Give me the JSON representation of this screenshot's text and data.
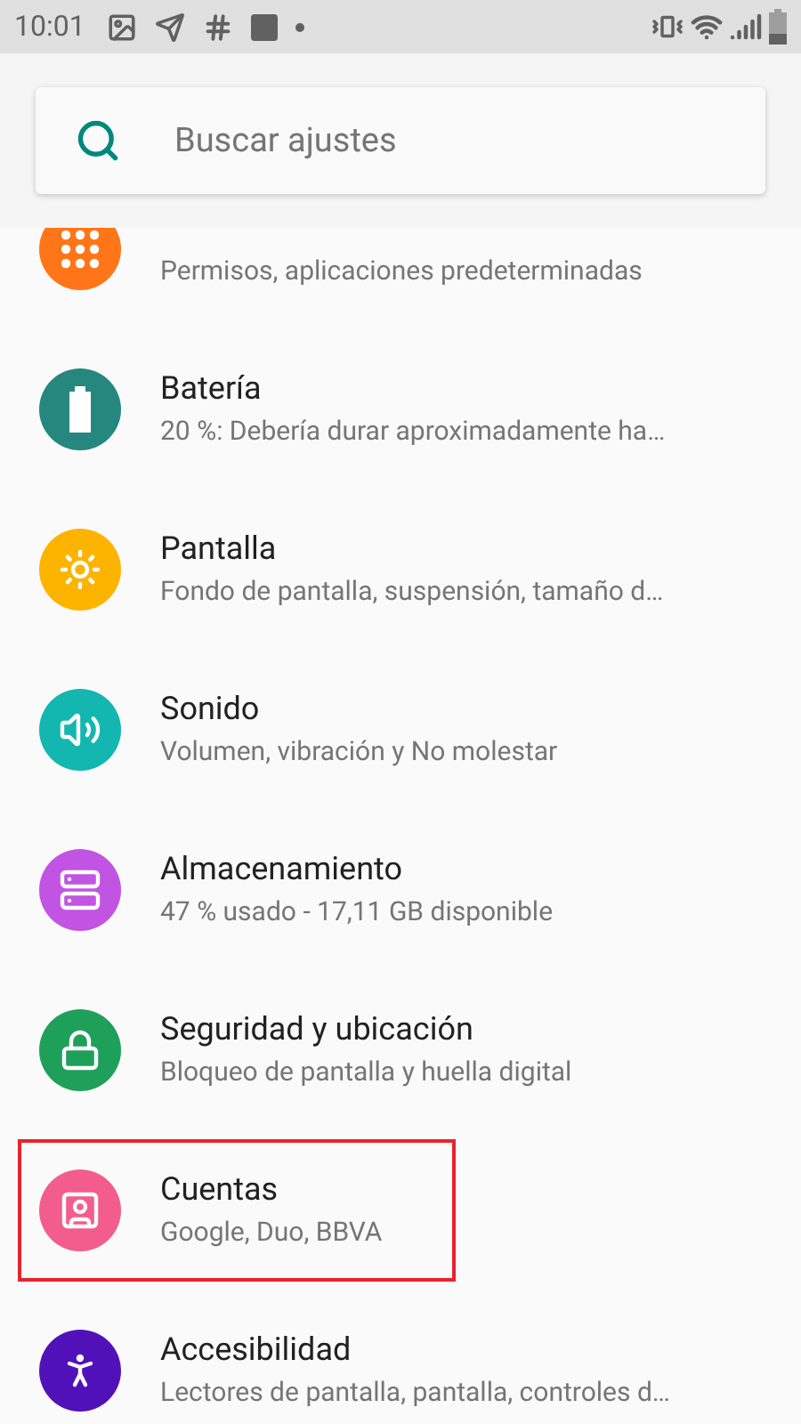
{
  "status_bar": {
    "time": "10:01"
  },
  "search": {
    "placeholder": "Buscar ajustes"
  },
  "items": [
    {
      "kind": "apps",
      "color": "#ff7518",
      "subtitle": "Permisos, aplicaciones predeterminadas",
      "highlighted": false
    },
    {
      "kind": "battery",
      "color": "#25877e",
      "title": "Batería",
      "subtitle": "20 %: Debería durar aproximadamente ha…",
      "highlighted": false
    },
    {
      "kind": "display",
      "color": "#fdb401",
      "title": "Pantalla",
      "subtitle": "Fondo de pantalla, suspensión, tamaño d…",
      "highlighted": false
    },
    {
      "kind": "sound",
      "color": "#14b6b0",
      "title": "Sonido",
      "subtitle": "Volumen, vibración y No molestar",
      "highlighted": false
    },
    {
      "kind": "storage",
      "color": "#c154e3",
      "title": "Almacenamiento",
      "subtitle": "47 % usado - 17,11 GB disponible",
      "highlighted": false
    },
    {
      "kind": "security",
      "color": "#1ea05a",
      "title": "Seguridad y ubicación",
      "subtitle": "Bloqueo de pantalla y huella digital",
      "highlighted": false
    },
    {
      "kind": "accounts",
      "color": "#f35d8e",
      "title": "Cuentas",
      "subtitle": "Google, Duo, BBVA",
      "highlighted": true
    },
    {
      "kind": "accessibility",
      "color": "#5012b8",
      "title": "Accesibilidad",
      "subtitle": "Lectores de pantalla, pantalla, controles d…",
      "highlighted": false
    }
  ]
}
